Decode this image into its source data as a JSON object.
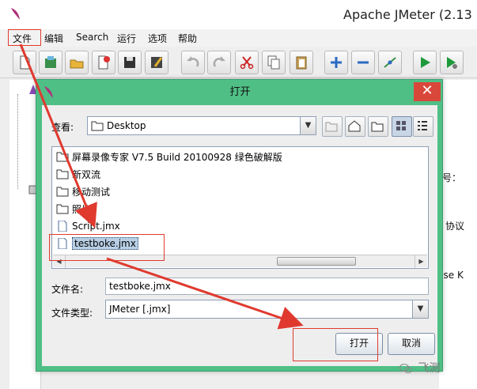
{
  "window": {
    "title": "Apache JMeter (2.13"
  },
  "menu": [
    "文件",
    "编辑",
    "Search",
    "运行",
    "选项",
    "帮助"
  ],
  "toolbar": {
    "icons": [
      "new-icon",
      "templates-icon",
      "open-icon",
      "close-icon",
      "save-icon",
      "save-as-icon",
      "undo-icon",
      "redo-icon",
      "cut-icon",
      "copy-icon",
      "paste-icon",
      "expand-icon",
      "collapse-icon",
      "toggle-icon",
      "start-icon",
      "start-no-pause-icon"
    ]
  },
  "right_panel": {
    "label_1": "号：",
    "label_2": "协议",
    "label_3": "Jse K"
  },
  "dialog": {
    "title": "打开",
    "close_glyph": "✕",
    "look_in_label": "查看:",
    "look_in_value": "Desktop",
    "files": [
      {
        "name": "屏幕录像专家 V7.5 Build 20100928 绿色破解版",
        "type": "folder"
      },
      {
        "name": "新双流",
        "type": "folder"
      },
      {
        "name": "移动测试",
        "type": "folder"
      },
      {
        "name": "照片",
        "type": "folder"
      },
      {
        "name": "Script.jmx",
        "type": "file"
      },
      {
        "name": "testboke.jmx",
        "type": "file",
        "selected": true
      }
    ],
    "file_name_label": "文件名:",
    "file_name_value": "testboke.jmx",
    "file_type_label": "文件类型:",
    "file_type_value": "JMeter [.jmx]",
    "open_button": "打开",
    "cancel_button": "取消"
  },
  "watermark": "飞测",
  "colors": {
    "dialog_frame": "#4fbf86",
    "annotation": "#e03a2f",
    "selection": "#b8cfe5"
  }
}
